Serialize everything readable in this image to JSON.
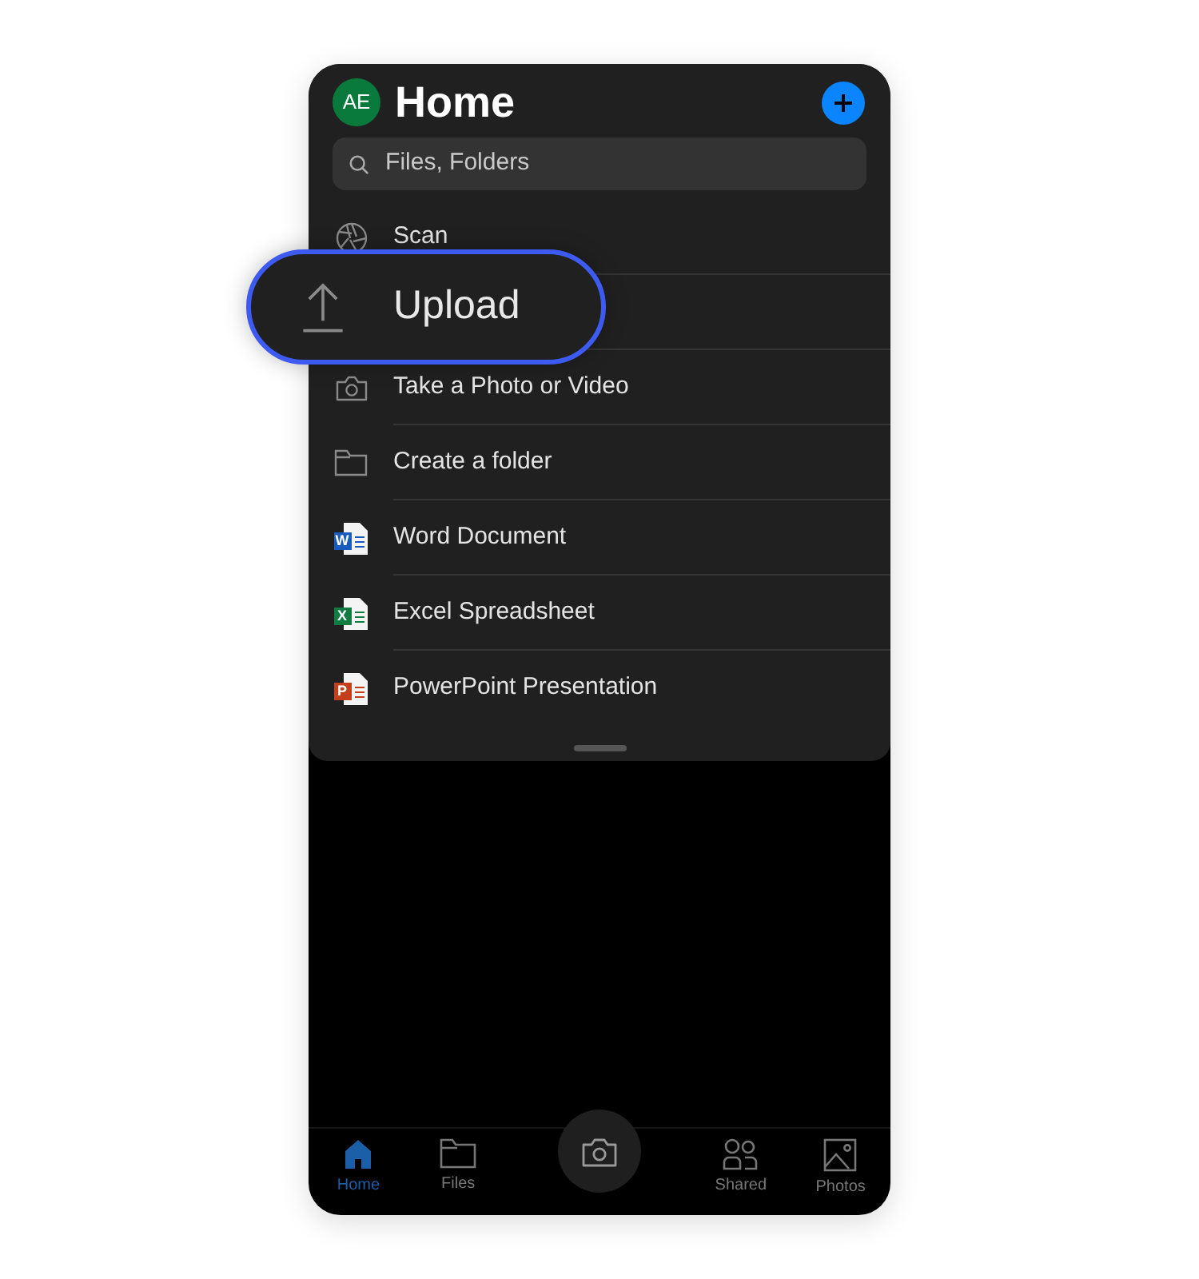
{
  "header": {
    "avatar": "AE",
    "title": "Home"
  },
  "search": {
    "placeholder": "Files, Folders"
  },
  "menu": [
    {
      "kind": "scan",
      "label": "Scan",
      "highlighted": false
    },
    {
      "kind": "upload",
      "label": "Upload",
      "highlighted": true
    },
    {
      "kind": "camera",
      "label": "Take a Photo or Video",
      "highlighted": false
    },
    {
      "kind": "folder",
      "label": "Create a folder",
      "highlighted": false
    },
    {
      "kind": "doc",
      "label": "Word Document",
      "letter": "W",
      "color": "#185abd",
      "highlighted": false
    },
    {
      "kind": "doc",
      "label": "Excel Spreadsheet",
      "letter": "X",
      "color": "#107c41",
      "highlighted": false
    },
    {
      "kind": "doc",
      "label": "PowerPoint Presentation",
      "letter": "P",
      "color": "#c43e1c",
      "highlighted": false
    }
  ],
  "nav": [
    {
      "kind": "home",
      "label": "Home",
      "selected": true
    },
    {
      "kind": "folder",
      "label": "Files",
      "selected": false
    },
    {
      "kind": "camera",
      "selected": false
    },
    {
      "kind": "shared",
      "label": "Shared",
      "selected": false
    },
    {
      "kind": "photos",
      "label": "Photos",
      "selected": false
    }
  ]
}
